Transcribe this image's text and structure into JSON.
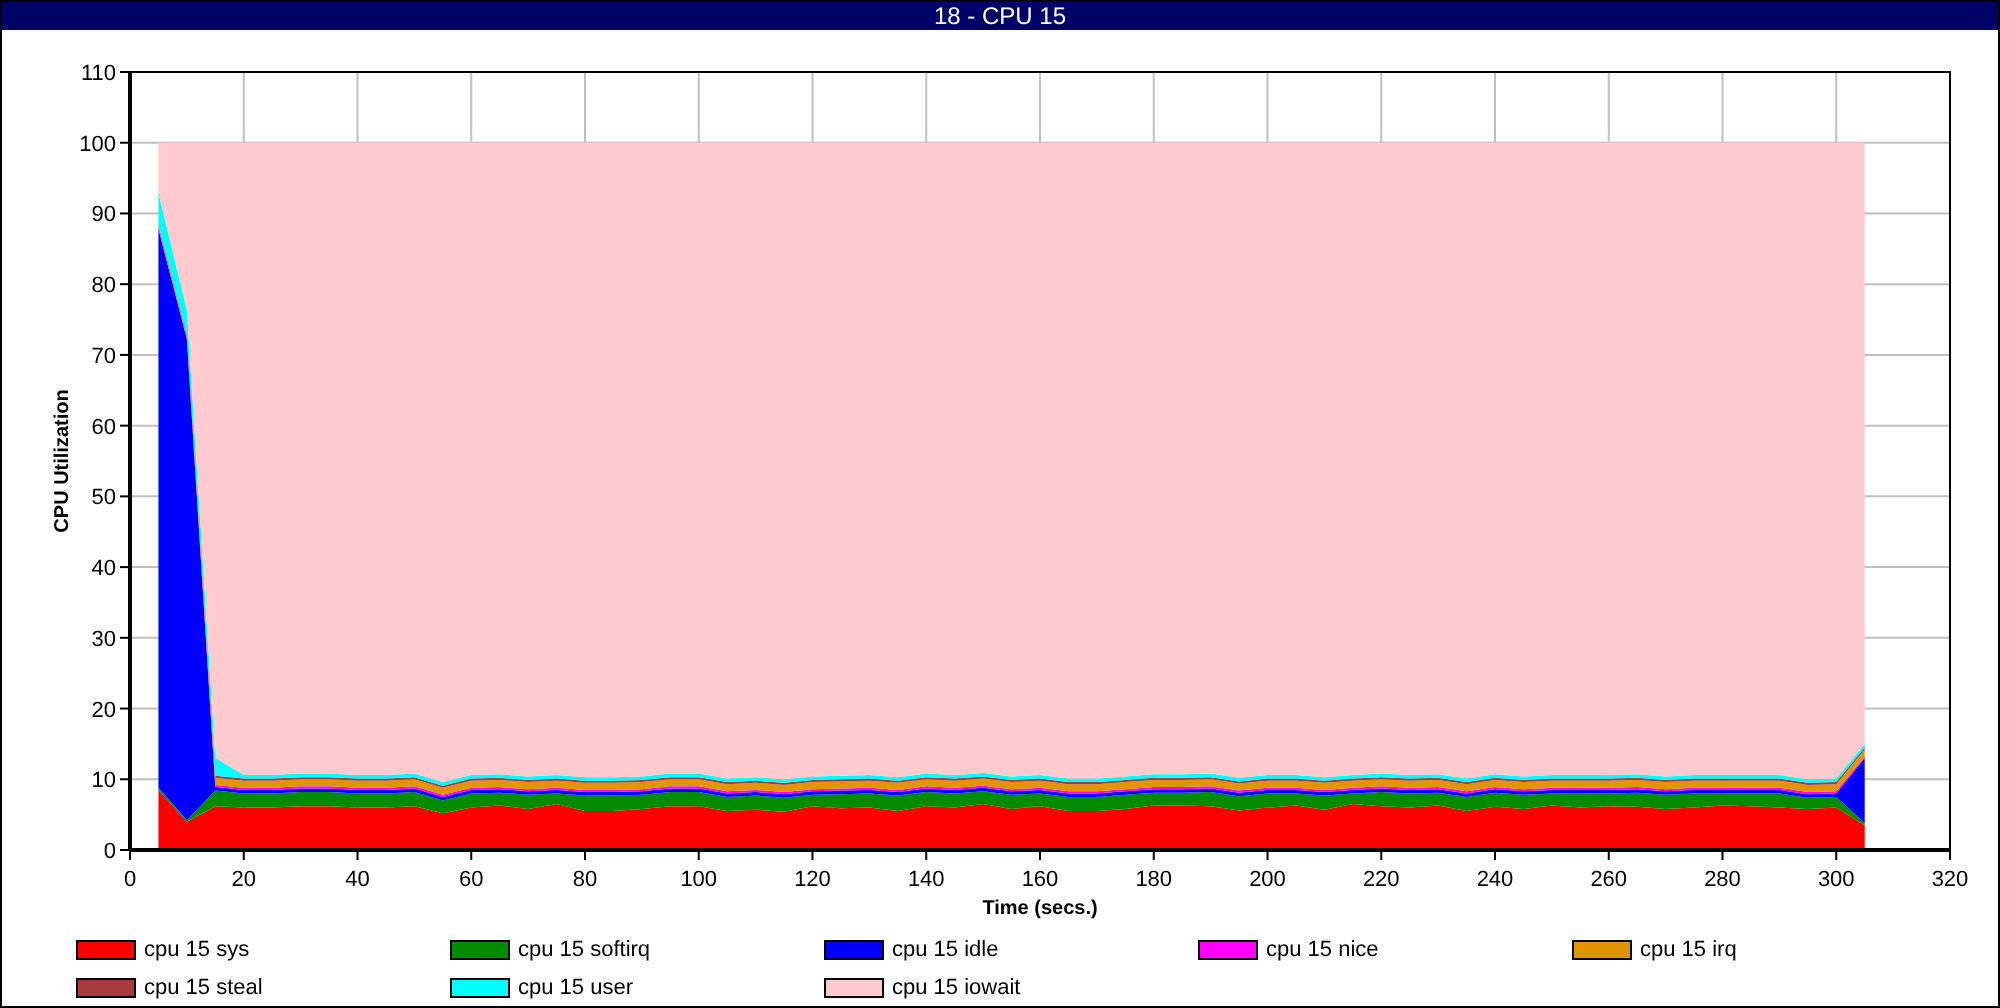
{
  "window": {
    "title": "18 - CPU 15"
  },
  "chart": {
    "chart_data": {
      "type": "area",
      "stacked": true,
      "grid": true,
      "xlabel": "Time (secs.)",
      "ylabel": "CPU Utilization",
      "xlim": [
        0,
        320
      ],
      "ylim": [
        0,
        110
      ],
      "xticks": [
        0,
        20,
        40,
        60,
        80,
        100,
        120,
        140,
        160,
        180,
        200,
        220,
        240,
        260,
        280,
        300,
        320
      ],
      "yticks": [
        0,
        10,
        20,
        30,
        40,
        50,
        60,
        70,
        80,
        90,
        100,
        110
      ],
      "x": [
        5,
        10,
        15,
        20,
        25,
        30,
        35,
        40,
        45,
        50,
        55,
        60,
        65,
        70,
        75,
        80,
        85,
        90,
        95,
        100,
        105,
        110,
        115,
        120,
        125,
        130,
        135,
        140,
        145,
        150,
        155,
        160,
        165,
        170,
        175,
        180,
        185,
        190,
        195,
        200,
        205,
        210,
        215,
        220,
        225,
        230,
        235,
        240,
        245,
        250,
        255,
        260,
        265,
        270,
        275,
        280,
        285,
        290,
        295,
        300,
        305
      ],
      "series": [
        {
          "name": "cpu 15 sys",
          "color": "#ff0000",
          "values": [
            8.5,
            4,
            6.2,
            6,
            6,
            6.2,
            6.2,
            6,
            6,
            6.2,
            5.2,
            6,
            6.3,
            5.8,
            6.5,
            5.5,
            5.5,
            5.8,
            6.2,
            6.2,
            5.5,
            5.7,
            5.4,
            6.2,
            5.9,
            6,
            5.5,
            6.2,
            6,
            6.5,
            5.8,
            6.2,
            5.5,
            5.5,
            5.8,
            6.3,
            6.3,
            6.2,
            5.6,
            6,
            6.3,
            5.7,
            6.5,
            6.2,
            6,
            6.3,
            5.5,
            6.1,
            5.8,
            6.3,
            6,
            6.2,
            6.1,
            5.8,
            6,
            6.3,
            6.2,
            6,
            5.8,
            6,
            3.5
          ]
        },
        {
          "name": "cpu 15 softirq",
          "color": "#008c00",
          "values": [
            0.3,
            0.2,
            2.2,
            2,
            2,
            2,
            2,
            2,
            2,
            2,
            1.8,
            2,
            1.8,
            2,
            1.5,
            2.2,
            2.2,
            2,
            2,
            2,
            2,
            2,
            2,
            1.6,
            2,
            2,
            2.2,
            2,
            2,
            1.8,
            2,
            1.8,
            2,
            2,
            2,
            1.8,
            1.8,
            2,
            2,
            2,
            1.7,
            2,
            1.5,
            2,
            2,
            1.8,
            2,
            2,
            2,
            1.7,
            2,
            1.8,
            2,
            2,
            2,
            1.7,
            1.8,
            2,
            1.6,
            1.5,
            0.3
          ]
        },
        {
          "name": "cpu 15 idle",
          "color": "#0000ff",
          "values": [
            79,
            68,
            0.5,
            0.5,
            0.5,
            0.5,
            0.5,
            0.5,
            0.5,
            0.5,
            0.5,
            0.5,
            0.5,
            0.5,
            0.5,
            0.5,
            0.5,
            0.5,
            0.5,
            0.5,
            0.5,
            0.5,
            0.5,
            0.5,
            0.5,
            0.5,
            0.5,
            0.5,
            0.5,
            0.5,
            0.5,
            0.5,
            0.5,
            0.5,
            0.5,
            0.5,
            0.5,
            0.5,
            0.5,
            0.5,
            0.5,
            0.5,
            0.5,
            0.5,
            0.5,
            0.5,
            0.5,
            0.5,
            0.5,
            0.5,
            0.5,
            0.5,
            0.5,
            0.5,
            0.5,
            0.5,
            0.5,
            0.5,
            0.5,
            0.5,
            9.2
          ]
        },
        {
          "name": "cpu 15 nice",
          "color": "#ff00ff",
          "values": [
            0.2,
            0.2,
            0.3,
            0.3,
            0.3,
            0.3,
            0.3,
            0.3,
            0.3,
            0.3,
            0.3,
            0.3,
            0.3,
            0.3,
            0.3,
            0.3,
            0.3,
            0.3,
            0.3,
            0.3,
            0.3,
            0.3,
            0.3,
            0.3,
            0.3,
            0.3,
            0.3,
            0.3,
            0.3,
            0.3,
            0.3,
            0.3,
            0.3,
            0.3,
            0.3,
            0.3,
            0.3,
            0.3,
            0.3,
            0.3,
            0.3,
            0.3,
            0.3,
            0.3,
            0.3,
            0.3,
            0.3,
            0.3,
            0.3,
            0.3,
            0.3,
            0.3,
            0.3,
            0.3,
            0.3,
            0.3,
            0.3,
            0.3,
            0.3,
            0.3,
            0.2
          ]
        },
        {
          "name": "cpu 15 irq",
          "color": "#e09600",
          "values": [
            0.1,
            0.1,
            1,
            1,
            1,
            1,
            1,
            1,
            1,
            1,
            1,
            1,
            1,
            1,
            1,
            1,
            1,
            1,
            1,
            1,
            1,
            1,
            1,
            1,
            1,
            1,
            1,
            1,
            1,
            1,
            1,
            1,
            1,
            1,
            1,
            1,
            1,
            1,
            1,
            1,
            1,
            1,
            1,
            1,
            1,
            1,
            1,
            1,
            1,
            1,
            1,
            1,
            1,
            1,
            1,
            1,
            1,
            1,
            1,
            1,
            1
          ]
        },
        {
          "name": "cpu 15 steal",
          "color": "#a83c3c",
          "values": [
            0.3,
            0.3,
            0.3,
            0.3,
            0.3,
            0.3,
            0.3,
            0.3,
            0.3,
            0.3,
            0.3,
            0.3,
            0.3,
            0.3,
            0.3,
            0.3,
            0.3,
            0.3,
            0.3,
            0.3,
            0.3,
            0.3,
            0.3,
            0.3,
            0.3,
            0.3,
            0.3,
            0.3,
            0.3,
            0.3,
            0.3,
            0.3,
            0.3,
            0.3,
            0.3,
            0.3,
            0.3,
            0.3,
            0.3,
            0.3,
            0.3,
            0.3,
            0.3,
            0.3,
            0.3,
            0.3,
            0.3,
            0.3,
            0.3,
            0.3,
            0.3,
            0.3,
            0.3,
            0.3,
            0.3,
            0.3,
            0.3,
            0.3,
            0.3,
            0.3,
            0.3
          ]
        },
        {
          "name": "cpu 15 user",
          "color": "#00ffff",
          "values": [
            4.5,
            3.5,
            2.5,
            0.5,
            0.5,
            0.5,
            0.5,
            0.5,
            0.5,
            0.5,
            0.5,
            0.5,
            0.5,
            0.5,
            0.5,
            0.5,
            0.5,
            0.5,
            0.5,
            0.5,
            0.5,
            0.5,
            0.5,
            0.5,
            0.5,
            0.5,
            0.5,
            0.5,
            0.5,
            0.5,
            0.5,
            0.5,
            0.5,
            0.5,
            0.5,
            0.5,
            0.5,
            0.5,
            0.5,
            0.5,
            0.5,
            0.5,
            0.5,
            0.5,
            0.5,
            0.5,
            0.5,
            0.5,
            0.5,
            0.5,
            0.5,
            0.5,
            0.5,
            0.5,
            0.5,
            0.5,
            0.5,
            0.5,
            0.5,
            0.5,
            0.5
          ]
        },
        {
          "name": "cpu 15 iowait",
          "color": "#ffcbcf",
          "values": [
            7.1,
            23.7,
            87,
            89.4,
            89.4,
            89.2,
            89.2,
            89.4,
            89.4,
            89.2,
            90.4,
            89.4,
            89.3,
            89.6,
            89.4,
            89.7,
            89.7,
            89.6,
            89.2,
            89.2,
            89.9,
            89.7,
            90,
            89.6,
            89.5,
            89.4,
            89.7,
            89.2,
            89.4,
            89.1,
            89.6,
            89.4,
            89.9,
            89.9,
            89.6,
            89.3,
            89.3,
            89.2,
            89.8,
            89.4,
            89.4,
            89.7,
            89.4,
            89.2,
            89.4,
            89.3,
            89.9,
            89.3,
            89.6,
            89.4,
            89.4,
            89.4,
            89.3,
            89.6,
            89.4,
            89.4,
            89.4,
            89.4,
            90,
            89.9,
            85
          ]
        }
      ]
    }
  }
}
